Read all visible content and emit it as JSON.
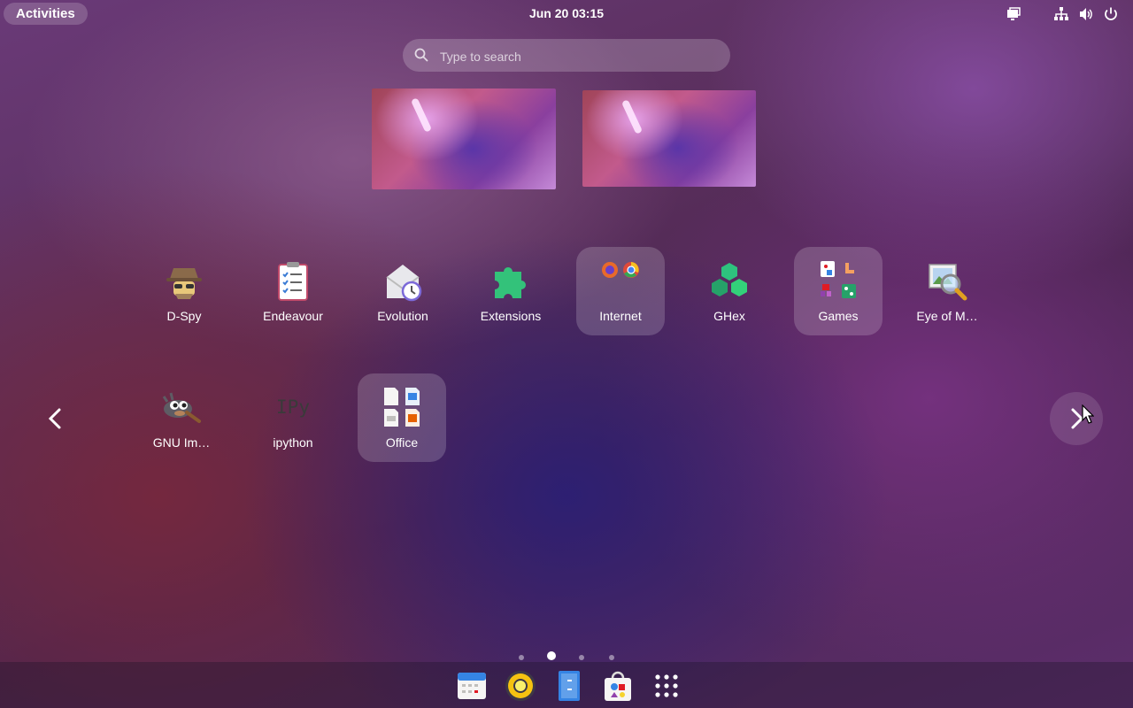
{
  "topbar": {
    "activities_label": "Activities",
    "clock": "Jun 20  03:15",
    "tray_icons": [
      "screen-share-icon",
      "network-icon",
      "volume-icon",
      "power-icon"
    ]
  },
  "search": {
    "placeholder": "Type to search",
    "value": ""
  },
  "workspaces": [
    "workspace-1",
    "workspace-2"
  ],
  "apps": {
    "row1": [
      {
        "label": "D-Spy",
        "icon": "dspy-icon",
        "folder": false
      },
      {
        "label": "Endeavour",
        "icon": "endeavour-icon",
        "folder": false
      },
      {
        "label": "Evolution",
        "icon": "evolution-icon",
        "folder": false
      },
      {
        "label": "Extensions",
        "icon": "extensions-icon",
        "folder": false
      },
      {
        "label": "Internet",
        "icon": "internet-folder-icon",
        "folder": true
      },
      {
        "label": "GHex",
        "icon": "ghex-icon",
        "folder": false
      },
      {
        "label": "Games",
        "icon": "games-folder-icon",
        "folder": true
      },
      {
        "label": "Eye of M…",
        "icon": "eye-of-mate-icon",
        "folder": false
      }
    ],
    "row2": [
      {
        "label": "GNU Im…",
        "icon": "gimp-icon",
        "folder": false
      },
      {
        "label": "ipython",
        "icon": "ipython-icon",
        "folder": false,
        "icon_text": "IPy"
      },
      {
        "label": "Office",
        "icon": "office-folder-icon",
        "folder": true
      }
    ]
  },
  "pager": {
    "pages": 4,
    "current": 2
  },
  "dash": [
    "calendar-icon",
    "rhythmbox-icon",
    "text-editor-icon",
    "software-icon",
    "show-apps-icon"
  ],
  "colors": {
    "accent": "#ffffff",
    "folder_bg": "rgba(255,255,255,0.18)"
  }
}
